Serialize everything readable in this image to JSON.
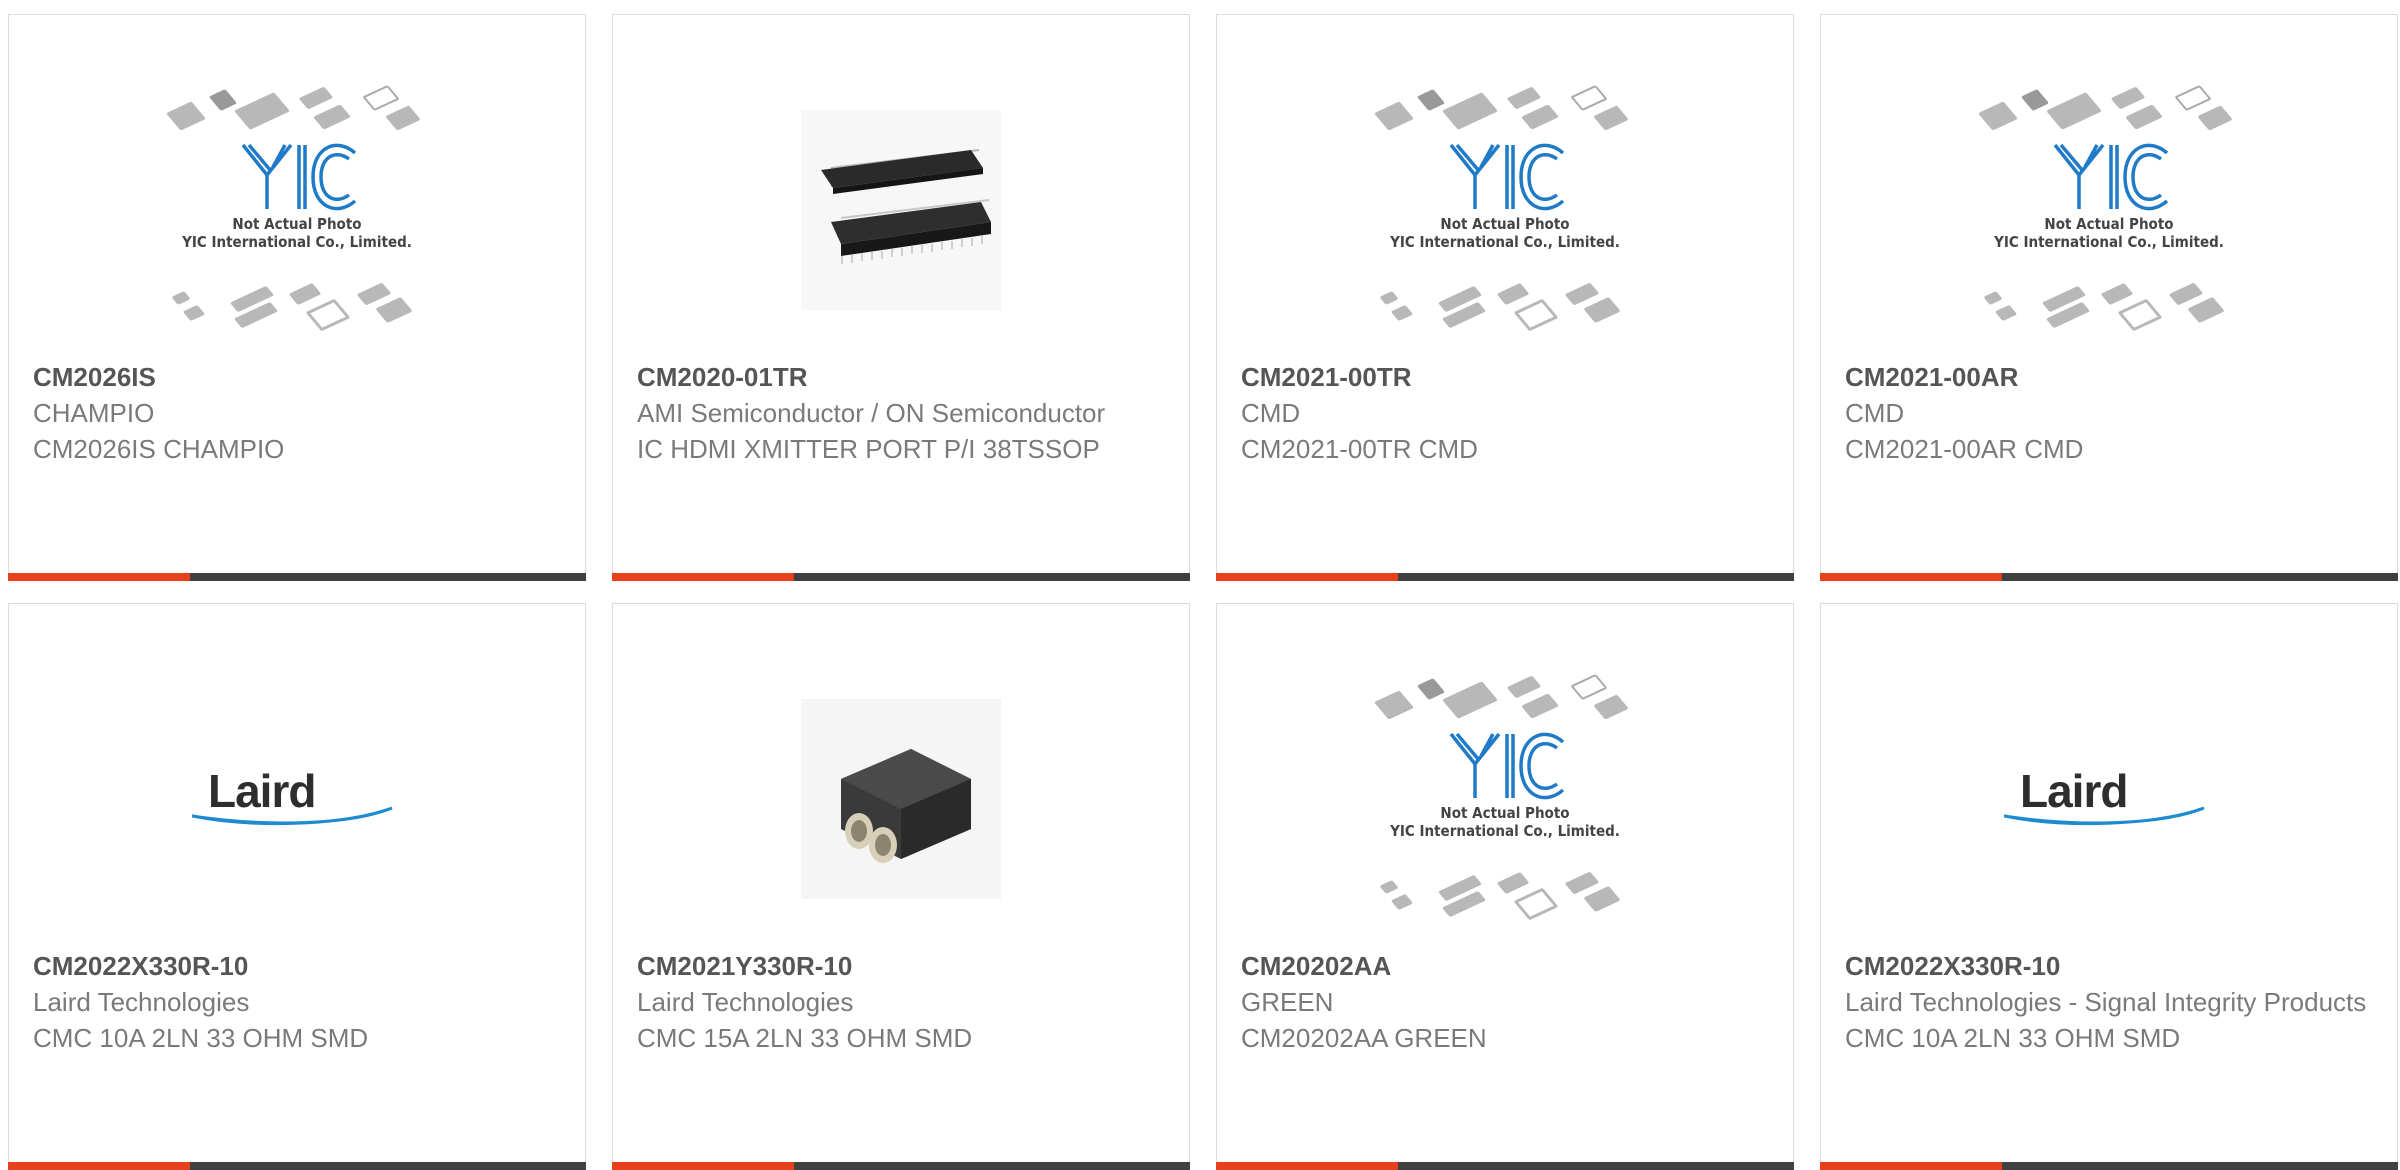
{
  "products": [
    {
      "part": "CM2026IS",
      "maker": "CHAMPIO",
      "desc": "CM2026IS CHAMPIO",
      "image": "yic-not-actual-photo"
    },
    {
      "part": "CM2020-01TR",
      "maker": "AMI Semiconductor / ON Semiconductor",
      "desc": "IC HDMI XMITTER PORT P/I 38TSSOP",
      "image": "ic-tssop-photo"
    },
    {
      "part": "CM2021-00TR",
      "maker": "CMD",
      "desc": "CM2021-00TR CMD",
      "image": "yic-not-actual-photo"
    },
    {
      "part": "CM2021-00AR",
      "maker": "CMD",
      "desc": "CM2021-00AR CMD",
      "image": "yic-not-actual-photo"
    },
    {
      "part": "CM2022X330R-10",
      "maker": "Laird Technologies",
      "desc": "CMC 10A 2LN 33 OHM SMD",
      "image": "laird-logo"
    },
    {
      "part": "CM2021Y330R-10",
      "maker": "Laird Technologies",
      "desc": "CMC 15A 2LN 33 OHM SMD",
      "image": "inductor-photo"
    },
    {
      "part": "CM20202AA",
      "maker": "GREEN",
      "desc": "CM20202AA GREEN",
      "image": "yic-not-actual-photo"
    },
    {
      "part": "CM2022X330R-10",
      "maker": "Laird Technologies - Signal Integrity Products",
      "desc": "CMC 10A 2LN 33 OHM SMD",
      "image": "laird-logo"
    }
  ],
  "placeholder": {
    "note_line1": "Not Actual Photo",
    "note_line2": "YIC International Co., Limited.",
    "logo_text": "YIC"
  },
  "laird_logo_text": "Laird",
  "colors": {
    "accent": "#e8401c",
    "bar": "#404040",
    "text": "#7a7a7a",
    "part": "#555555"
  }
}
